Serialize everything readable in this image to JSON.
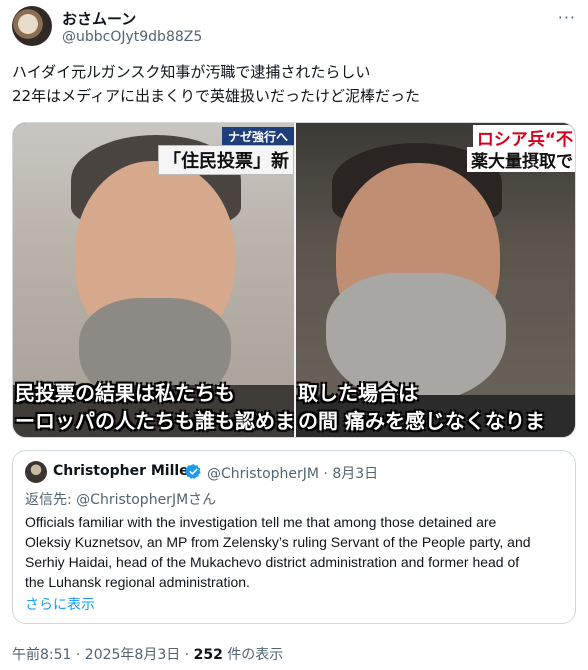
{
  "author": {
    "display_name": "おさムーン",
    "handle": "@ubbcOJyt9db88Z5"
  },
  "menu": {
    "more_label": "···"
  },
  "tweet": {
    "lines": [
      "ハイダイ元ルガンスク知事が汚職で逮捕されたらしい",
      "22年はメディアに出まくりで英雄扱いだったけど泥棒だった"
    ]
  },
  "media": {
    "left": {
      "tag_top": "ナゼ強行へ",
      "tag_main": "「住民投票」新",
      "subtitle_1": "民投票の結果は私たちも",
      "subtitle_2": "ーロッパの人たちも誰も認めま"
    },
    "right": {
      "tag_top": "ロシア兵“不",
      "tag_main": "薬大量摂取で",
      "subtitle_1": "取した場合は",
      "subtitle_2": "の間 痛みを感じなくなりま"
    }
  },
  "quote": {
    "name": "Christopher Miller",
    "handle_date": "@ChristopherJM · 8月3日",
    "reply_to": "返信先: @ChristopherJMさん",
    "body_lines": [
      "Officials familiar with the investigation tell me that among those detained are",
      "Oleksiy Kuznetsov, an MP from Zelensky’s ruling Servant of the People party, and",
      "Serhiy Haidai, head of the Mukachevo district administration and former head of",
      "the Luhansk regional administration."
    ],
    "show_more": "さらに表示"
  },
  "meta": {
    "timestamp": "午前8:51 · 2025年8月3日 · ",
    "view_count": "252",
    "view_suffix": " 件の表示"
  },
  "colors": {
    "accent": "#1d9bf0",
    "subtitle_red": "#d6001c",
    "text_secondary": "#536471"
  }
}
